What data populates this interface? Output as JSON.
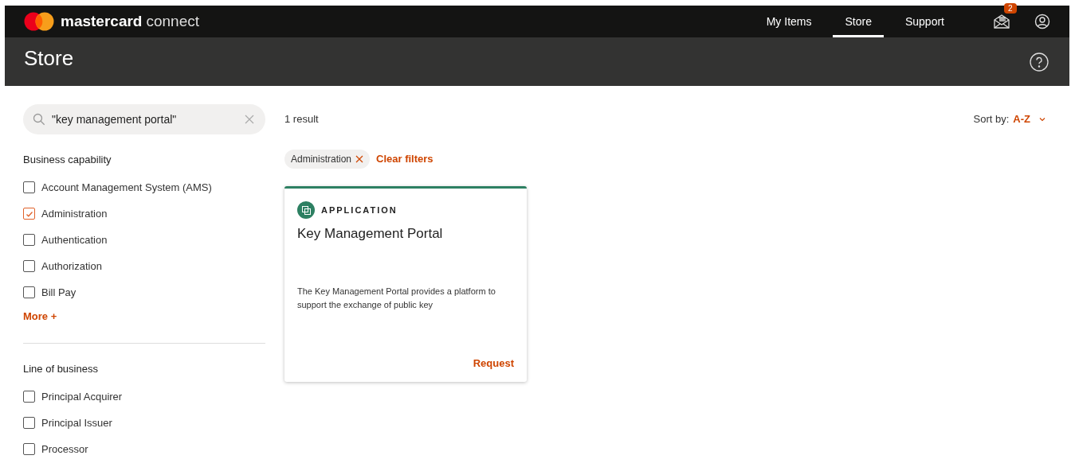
{
  "brand": {
    "name": "mastercard",
    "product": "connect"
  },
  "nav": [
    {
      "label": "My Items",
      "selected": false
    },
    {
      "label": "Store",
      "selected": true
    },
    {
      "label": "Support",
      "selected": false
    }
  ],
  "notifications": {
    "count": "2"
  },
  "page_title": "Store",
  "search": {
    "value": "\"key management portal\""
  },
  "filter_groups": [
    {
      "title": "Business capability",
      "options": [
        {
          "label": "Account Management System (AMS)",
          "checked": false
        },
        {
          "label": "Administration",
          "checked": true
        },
        {
          "label": "Authentication",
          "checked": false
        },
        {
          "label": "Authorization",
          "checked": false
        },
        {
          "label": "Bill Pay",
          "checked": false
        }
      ],
      "more": "More +"
    },
    {
      "title": "Line of business",
      "options": [
        {
          "label": "Principal Acquirer",
          "checked": false
        },
        {
          "label": "Principal Issuer",
          "checked": false
        },
        {
          "label": "Processor",
          "checked": false
        }
      ]
    }
  ],
  "result_count": "1 result",
  "sort": {
    "label": "Sort by:",
    "value": "A-Z"
  },
  "active_filters": [
    {
      "label": "Administration"
    }
  ],
  "clear_filters": "Clear filters",
  "cards": [
    {
      "type": "APPLICATION",
      "title": "Key Management Portal",
      "description": "The Key Management Portal provides a platform to support the exchange of public key",
      "action": "Request"
    }
  ]
}
